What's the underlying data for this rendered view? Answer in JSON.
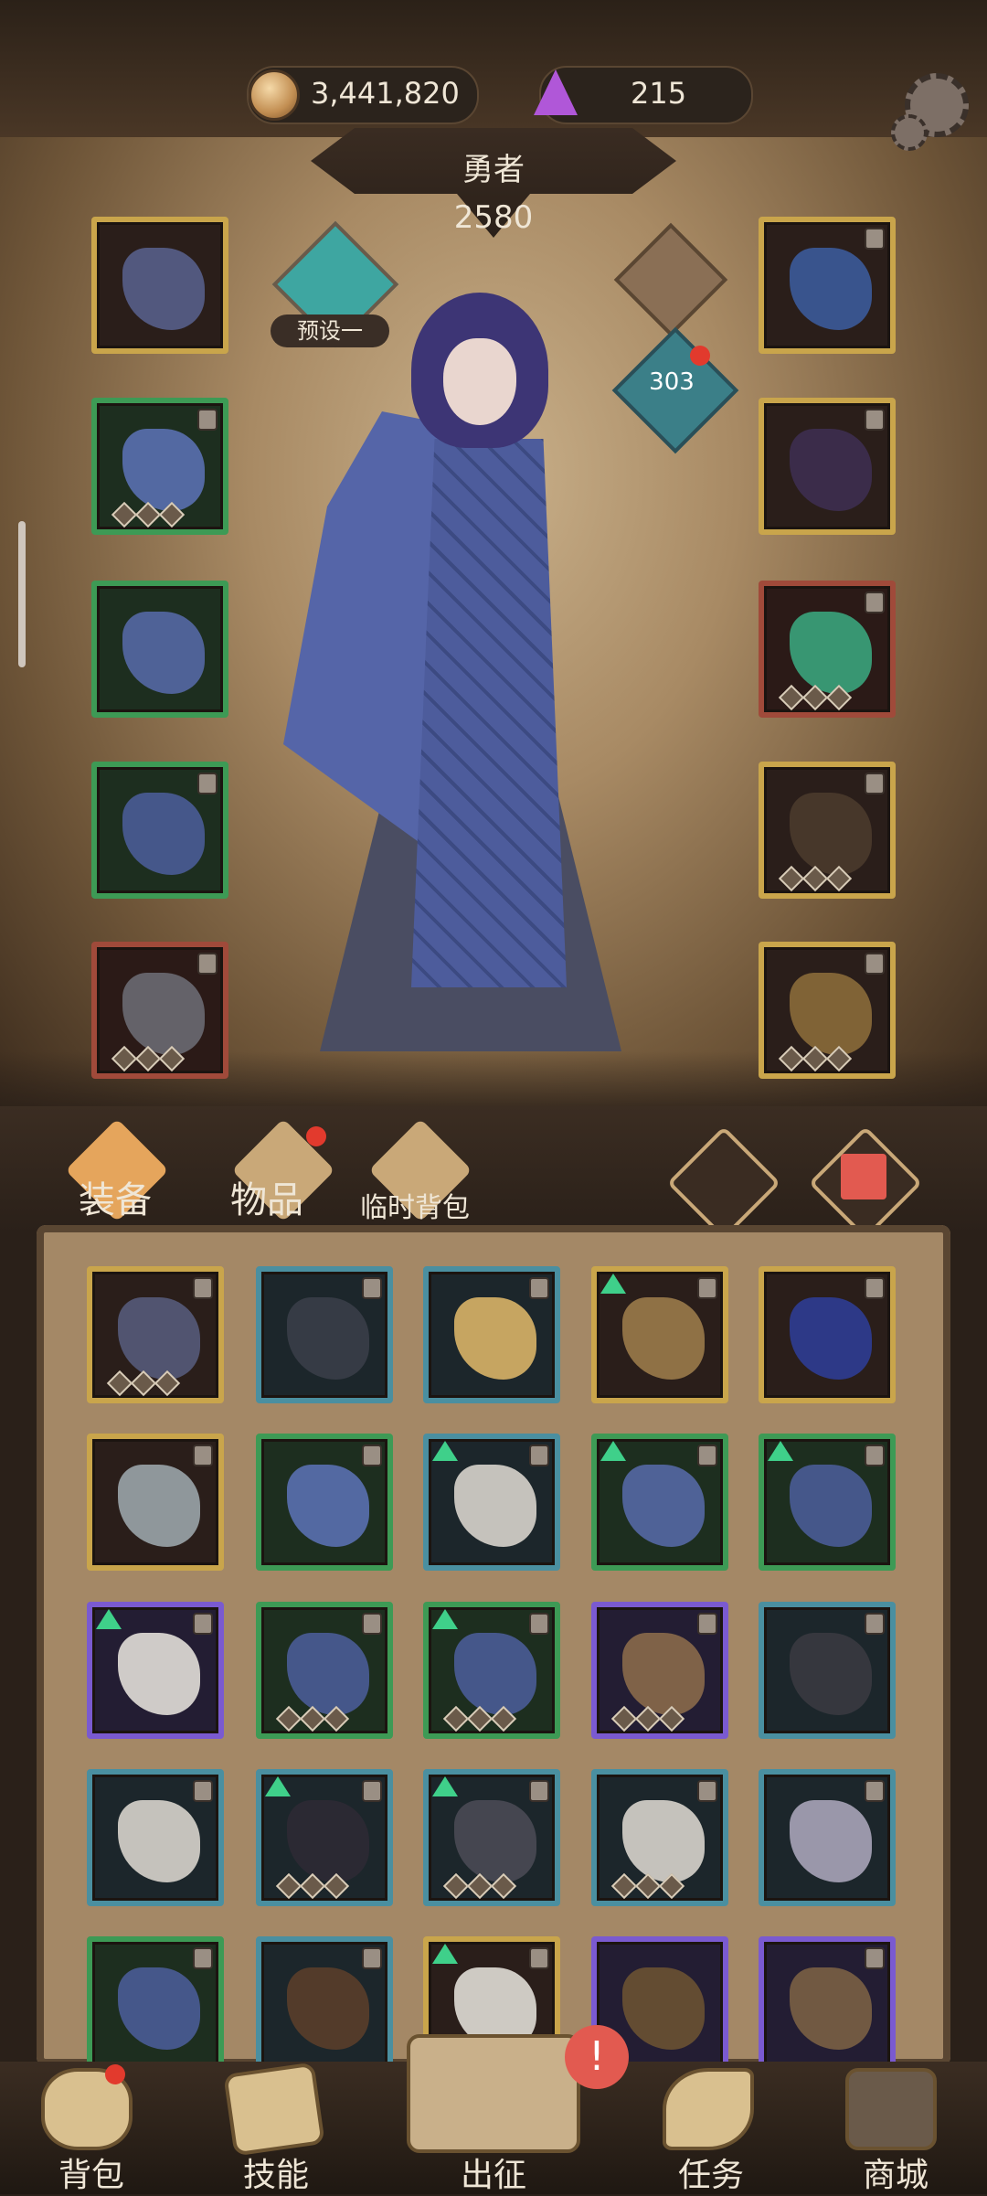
{
  "resources": {
    "coins": "3,441,820",
    "gems": "215"
  },
  "hero": {
    "class_name": "勇者",
    "power": "2580",
    "preset_label": "预设一",
    "level": "303"
  },
  "tabs": [
    {
      "label": "装备",
      "icon": "equipment-tab-icon"
    },
    {
      "label": "物品",
      "icon": "items-tab-icon"
    },
    {
      "label": "临时背包",
      "icon": "temp-bag-tab-icon"
    }
  ],
  "bottom_nav": [
    {
      "label": "背包",
      "icon": "backpack-icon"
    },
    {
      "label": "技能",
      "icon": "skill-icon"
    },
    {
      "label": "出征",
      "icon": "expedition-icon"
    },
    {
      "label": "任务",
      "icon": "task-icon"
    },
    {
      "label": "商城",
      "icon": "shop-icon"
    }
  ],
  "colors": {
    "gold_frame": "#c9a54b",
    "green_frame": "#3d9a55",
    "teal_frame": "#4a8fa0",
    "purple_frame": "#7a5ad0",
    "red_frame": "#a04a3a",
    "notification": "#e23a2d"
  }
}
